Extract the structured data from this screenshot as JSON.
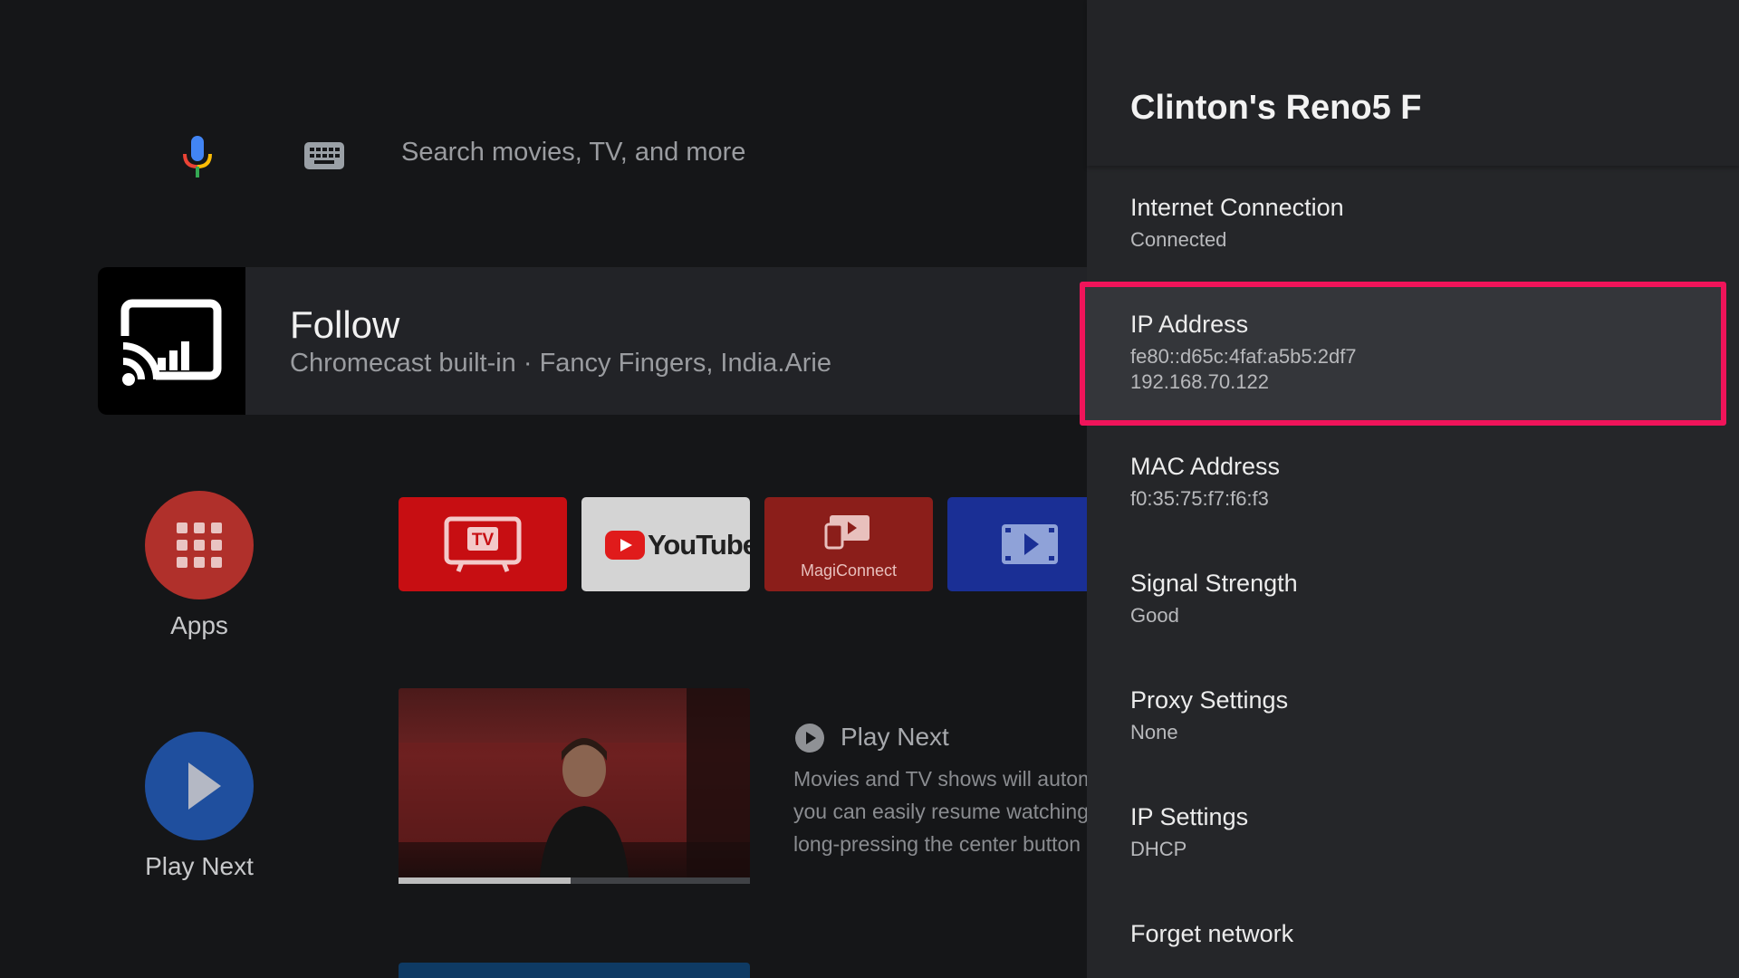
{
  "search": {
    "placeholder": "Search movies, TV, and more"
  },
  "now_playing": {
    "title": "Follow",
    "subtitle": "Chromecast built-in · Fancy Fingers, India.Arie"
  },
  "launcher": {
    "apps_label": "Apps",
    "play_next_label": "Play Next"
  },
  "app_tiles": {
    "tv_label": "TV",
    "youtube_label": "YouTube",
    "magicconnect_label": "MagiConnect"
  },
  "play_next": {
    "heading": "Play Next",
    "desc_lines": [
      "Movies and TV shows will autom",
      "you can easily resume watching",
      "long-pressing the center button"
    ],
    "progress": 0.49
  },
  "panel": {
    "title": "Clinton's Reno5 F",
    "settings": [
      {
        "label": "Internet Connection",
        "value": "Connected"
      },
      {
        "label": "IP Address",
        "value": "fe80::d65c:4faf:a5b5:2df7",
        "value2": "192.168.70.122"
      },
      {
        "label": "MAC Address",
        "value": "f0:35:75:f7:f6:f3"
      },
      {
        "label": "Signal Strength",
        "value": "Good"
      },
      {
        "label": "Proxy Settings",
        "value": "None"
      },
      {
        "label": "IP Settings",
        "value": "DHCP"
      },
      {
        "label": "Forget network"
      }
    ]
  },
  "colors": {
    "highlight": "#f0145a",
    "apps_button": "#b0302b",
    "play_next_button": "#1f4f9e",
    "tv_tile": "#c70e12",
    "youtube_red": "#e01b1b"
  }
}
